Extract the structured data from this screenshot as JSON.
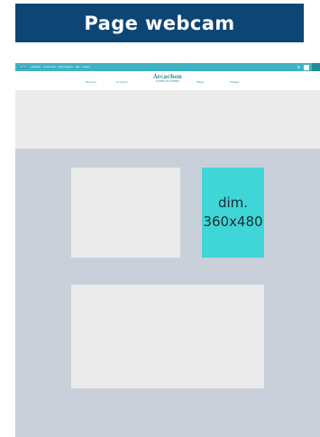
{
  "banner": {
    "title": "Page webcam"
  },
  "site": {
    "topbar_links": [
      "webcam",
      "actualités",
      "événements",
      "infos pratiques",
      "aide",
      "contact"
    ],
    "logo_name": "Arcachon",
    "logo_tagline": "a wave of a dream",
    "nav_left": [
      "Découvrir",
      "Se divertir"
    ],
    "nav_right": [
      "Plages",
      "Partager"
    ]
  },
  "placeholder": {
    "dim_label": "dim.",
    "dim_value": "360x480"
  },
  "colors": {
    "banner": "#0d4674",
    "topbar": "#3fb3c4",
    "accent_box": "#3ed6d6",
    "canvas": "#c9d0da"
  }
}
